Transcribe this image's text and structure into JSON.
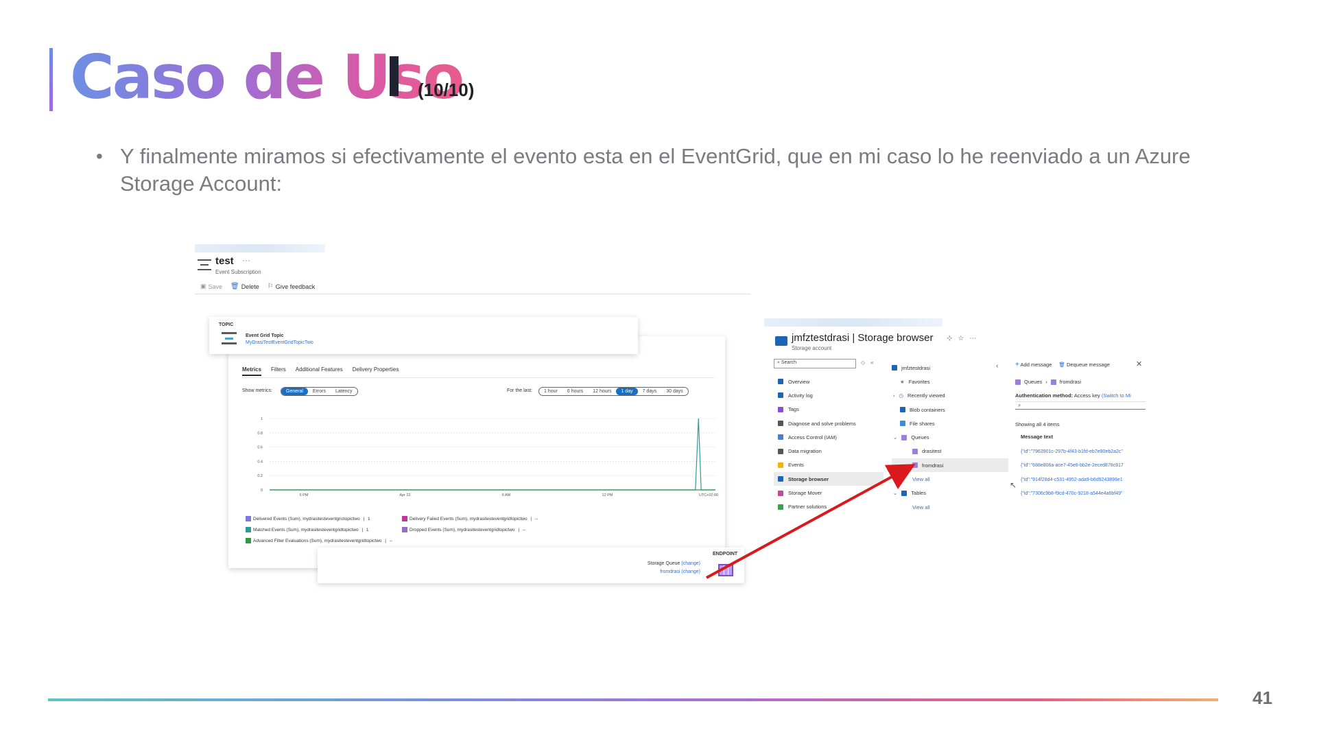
{
  "slide": {
    "title": "Caso de Uso",
    "title_suffix": "(10/10)",
    "bullet": "Y finalmente miramos si efectivamente el evento esta en el EventGrid, que en mi caso lo he reenviado a un Azure Storage Account:",
    "page_number": "41"
  },
  "event_subscription": {
    "name": "test",
    "more": "···",
    "type": "Event Subscription",
    "toolbar": [
      "Save",
      "Delete",
      "Give feedback"
    ],
    "topic_label": "TOPIC",
    "topic_type": "Event Grid Topic",
    "topic_name": "MyDrasiTestEventGridTopicTwo",
    "tabs": [
      "Metrics",
      "Filters",
      "Additional Features",
      "Delivery Properties"
    ],
    "show_metrics_label": "Show metrics:",
    "metric_options": [
      "General",
      "Errors",
      "Latency"
    ],
    "for_last_label": "For the last:",
    "time_options": [
      "1 hour",
      "6 hours",
      "12 hours",
      "1 day",
      "7 days",
      "30 days"
    ],
    "legend": [
      {
        "label": "Delivered Events (Sum), mydrasitesteventgrictopictwo",
        "value": "1",
        "color": "#7a7ae0"
      },
      {
        "label": "Delivery Failed Events (Sum), mydrasitesteventgridtopictwo",
        "value": "--",
        "color": "#c2359a"
      },
      {
        "label": "Matched Events (Sum), mydrasitesteventgridtopictwo",
        "value": "1",
        "color": "#2c9c9a"
      },
      {
        "label": "Dropped Events (Sum), mydrasitesteventgridtopictwo",
        "value": "--",
        "color": "#9a6bc9"
      },
      {
        "label": "Advanced Filter Evaluations (Sum), mydrasitesteventgridtopictwo",
        "value": "--",
        "color": "#2f9a3f"
      }
    ],
    "endpoint_label": "ENDPOINT",
    "endpoint_type": "Storage Queue",
    "endpoint_name": "fromdrasi",
    "change_label": "(change)"
  },
  "chart_data": {
    "type": "line",
    "x_tick_labels": [
      "6 PM",
      "Apr 22",
      "6 AM",
      "12 PM",
      "UTC+02:00"
    ],
    "y_ticks": [
      "1",
      "0.8",
      "0.6",
      "0.4",
      "0.2",
      "0"
    ],
    "ylim": [
      0,
      1
    ],
    "series": [
      {
        "name": "Delivered Events (Sum)",
        "points": [
          [
            0,
            0
          ],
          [
            0.955,
            0
          ],
          [
            0.962,
            1
          ],
          [
            0.968,
            0
          ],
          [
            1,
            0
          ]
        ],
        "color": "#2c9c9a"
      },
      {
        "name": "Matched Events (Sum)",
        "points": [
          [
            0,
            0
          ],
          [
            1,
            0
          ]
        ],
        "color": "#2f9a3f"
      }
    ]
  },
  "storage_browser": {
    "account": "jmfztestdrasi",
    "title_suffix": "| Storage browser",
    "subtitle": "Storage account",
    "search_placeholder": "Search",
    "nav": [
      {
        "label": "Overview",
        "color": "#1e64b4"
      },
      {
        "label": "Activity log",
        "color": "#1e64b4"
      },
      {
        "label": "Tags",
        "color": "#8a4fd0"
      },
      {
        "label": "Diagnose and solve problems",
        "color": "#555"
      },
      {
        "label": "Access Control (IAM)",
        "color": "#4a7fd0"
      },
      {
        "label": "Data migration",
        "color": "#555"
      },
      {
        "label": "Events",
        "color": "#f2b400"
      },
      {
        "label": "Storage browser",
        "color": "#1e64b4"
      },
      {
        "label": "Storage Mover",
        "color": "#c04aa0"
      },
      {
        "label": "Partner solutions",
        "color": "#3aa050"
      }
    ],
    "tree": [
      {
        "label": "jmfztestdrasi",
        "indent": 0
      },
      {
        "label": "Favorites",
        "indent": 1
      },
      {
        "label": "Recently viewed",
        "indent": 1
      },
      {
        "label": "Blob containers",
        "indent": 1
      },
      {
        "label": "File shares",
        "indent": 1
      },
      {
        "label": "Queues",
        "indent": 1
      },
      {
        "label": "drasitest",
        "indent": 2
      },
      {
        "label": "fromdrasi",
        "indent": 2
      },
      {
        "label": "View all",
        "indent": 2
      },
      {
        "label": "Tables",
        "indent": 1
      },
      {
        "label": "View all",
        "indent": 2
      }
    ],
    "add_message": "Add message",
    "dequeue_message": "Dequeue message",
    "breadcrumb": [
      "Queues",
      "fromdrasi"
    ],
    "auth_label": "Authentication method:",
    "auth_value": "Access key",
    "auth_switch": "(Switch to Mi",
    "showing": "Showing all 4 items",
    "column": "Message text",
    "messages": [
      "{\"id\":\"7963901c-297b-4f43-b1fd-eb7e90eb2a2c\"",
      "{\"id\":\"688e806a-ace7-45e8-bb2e-2eced878c817",
      "{\"id\":\"914f28d4-c531-4952-ada9-b6d9243898e1",
      "{\"id\":\"7306c9b8-f9cd-470c-9218-a544e4a6bf49\""
    ]
  }
}
